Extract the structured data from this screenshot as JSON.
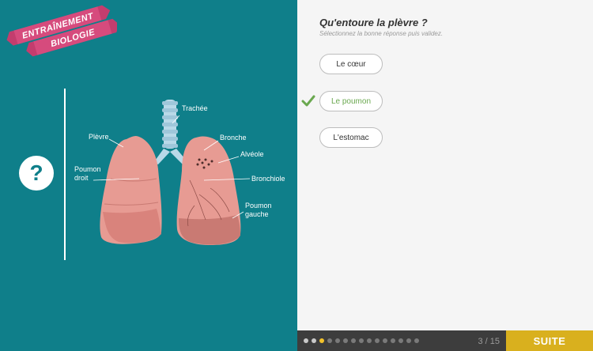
{
  "banner": {
    "line1": "ENTRAÎNEMENT",
    "line2": "BIOLOGIE"
  },
  "help": {
    "symbol": "?"
  },
  "diagram": {
    "labels": {
      "trachee": "Trachée",
      "plevre": "Plèvre",
      "bronche": "Bronche",
      "alveole": "Alvéole",
      "poumon_droit_1": "Poumon",
      "poumon_droit_2": "droit",
      "bronchiole": "Bronchiole",
      "poumon_gauche_1": "Poumon",
      "poumon_gauche_2": "gauche"
    }
  },
  "question": {
    "title": "Qu'entoure la plèvre ?",
    "instruction": "Sélectionnez la bonne réponse puis validez."
  },
  "answers": [
    {
      "label": "Le cœur",
      "state": "neutral"
    },
    {
      "label": "Le poumon",
      "state": "correct"
    },
    {
      "label": "L'estomac",
      "state": "neutral"
    }
  ],
  "footer": {
    "progress": {
      "current": 3,
      "total": 15
    },
    "pager_text": "3 / 15",
    "next_label": "SUITE"
  },
  "colors": {
    "panel": "#0f7f8a",
    "ribbon": "#d64b7d",
    "correct": "#6aa84f",
    "accent": "#d9b01e"
  }
}
